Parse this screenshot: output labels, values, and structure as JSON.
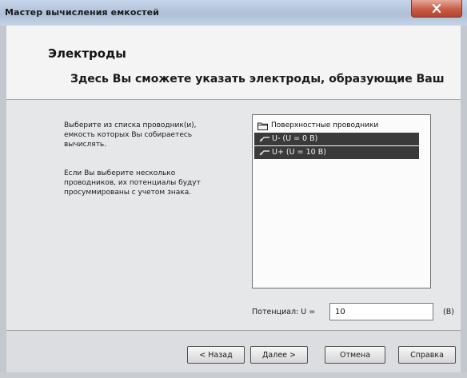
{
  "window": {
    "title": "Мастер вычисления емкостей",
    "close_icon": "close-icon"
  },
  "header": {
    "title": "Электроды",
    "subtitle": "Здесь Вы сможете указать электроды, образующие Ваш"
  },
  "description": {
    "paragraph1": "Выберите из списка проводник(и), емкость которых Вы собираетесь вычислять.",
    "paragraph2": "Если Вы выберите несколько проводников, их потенциалы будут просуммированы с учетом знака."
  },
  "conductors": {
    "group_label": "Поверхностные проводники",
    "group_icon": "folder-icon",
    "items": [
      {
        "label": "U- (U = 0 B)",
        "icon": "conductor-icon",
        "selected": true
      },
      {
        "label": "U+ (U = 10 B)",
        "icon": "conductor-icon",
        "selected": true
      }
    ]
  },
  "potential": {
    "label": "Потенциал:  U =",
    "value": "10",
    "unit": "(В)"
  },
  "buttons": {
    "back": "< Назад",
    "next": "Далее >",
    "cancel": "Отмена",
    "help": "Справка"
  },
  "colors": {
    "selection": "#3a3a3a",
    "close_button": "#c85c47"
  }
}
